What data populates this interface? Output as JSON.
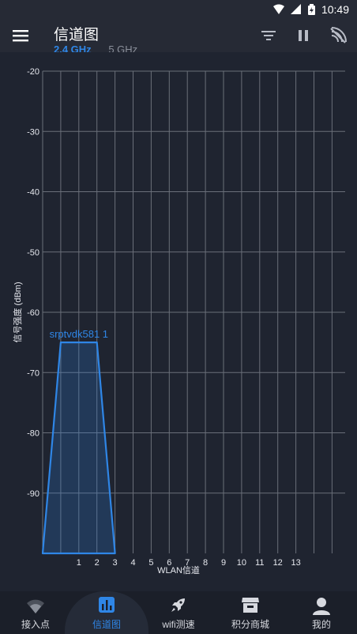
{
  "status_bar": {
    "time": "10:49"
  },
  "app_bar": {
    "title": "信道图",
    "tab_24": "2.4 GHz",
    "tab_5": "5 GHz"
  },
  "chart_data": {
    "type": "area",
    "xlabel": "WLAN信道",
    "ylabel": "信号强度 (dBm)",
    "x_ticks": [
      "1",
      "2",
      "3",
      "4",
      "5",
      "6",
      "7",
      "8",
      "9",
      "10",
      "11",
      "12",
      "13"
    ],
    "y_ticks": [
      "-20",
      "-30",
      "-40",
      "-50",
      "-60",
      "-70",
      "-80",
      "-90"
    ],
    "ylim": [
      -100,
      -20
    ],
    "grid": true,
    "series": [
      {
        "name": "srptvdk581 1",
        "channel": 1,
        "signal_dbm": -65,
        "color": "#2f86e6"
      }
    ]
  },
  "bottom_nav": {
    "items": [
      {
        "label": "接入点",
        "icon": "wifi-icon",
        "active": false
      },
      {
        "label": "信道图",
        "icon": "bar-chart-icon",
        "active": true
      },
      {
        "label": "wifi测速",
        "icon": "rocket-icon",
        "active": false
      },
      {
        "label": "积分商城",
        "icon": "store-icon",
        "active": false
      },
      {
        "label": "我的",
        "icon": "person-icon",
        "active": false
      }
    ]
  },
  "colors": {
    "accent": "#2f86e6",
    "background": "#1f2430",
    "grid": "#6a6f79"
  }
}
